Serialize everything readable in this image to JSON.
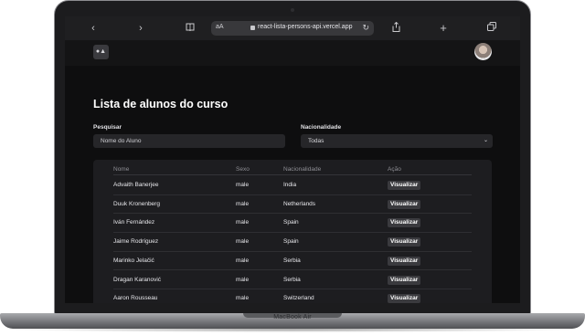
{
  "browser": {
    "text_size_label": "aA",
    "address": "react-lista-persons-api.vercel.app",
    "icons": [
      "back-icon",
      "forward-icon",
      "book-icon",
      "lock-icon",
      "reload-icon",
      "share-icon",
      "plus-icon",
      "tabs-icon"
    ]
  },
  "device": {
    "label": "MacBook Air"
  },
  "page": {
    "title": "Lista de alunos do curso",
    "search": {
      "label": "Pesquisar",
      "placeholder": "Nome do Aluno"
    },
    "nationality": {
      "label": "Nacionalidade",
      "selected": "Todas"
    }
  },
  "table": {
    "headers": [
      "Nome",
      "Sexo",
      "Nacionalidade",
      "Ação"
    ],
    "action_label": "Visualizar",
    "rows": [
      {
        "name": "Advaith Banerjee",
        "sex": "male",
        "nationality": "India"
      },
      {
        "name": "Duuk Kronenberg",
        "sex": "male",
        "nationality": "Netherlands"
      },
      {
        "name": "Iván Fernández",
        "sex": "male",
        "nationality": "Spain"
      },
      {
        "name": "Jaime Rodríguez",
        "sex": "male",
        "nationality": "Spain"
      },
      {
        "name": "Marinko Jelačić",
        "sex": "male",
        "nationality": "Serbia"
      },
      {
        "name": "Dragan Karanović",
        "sex": "male",
        "nationality": "Serbia"
      },
      {
        "name": "Aaron Rousseau",
        "sex": "male",
        "nationality": "Switzerland"
      }
    ]
  },
  "colors": {
    "background": "#0e0e0f",
    "card": "#1d1d20",
    "button": "#3a3a3e",
    "text": "#ffffff"
  }
}
